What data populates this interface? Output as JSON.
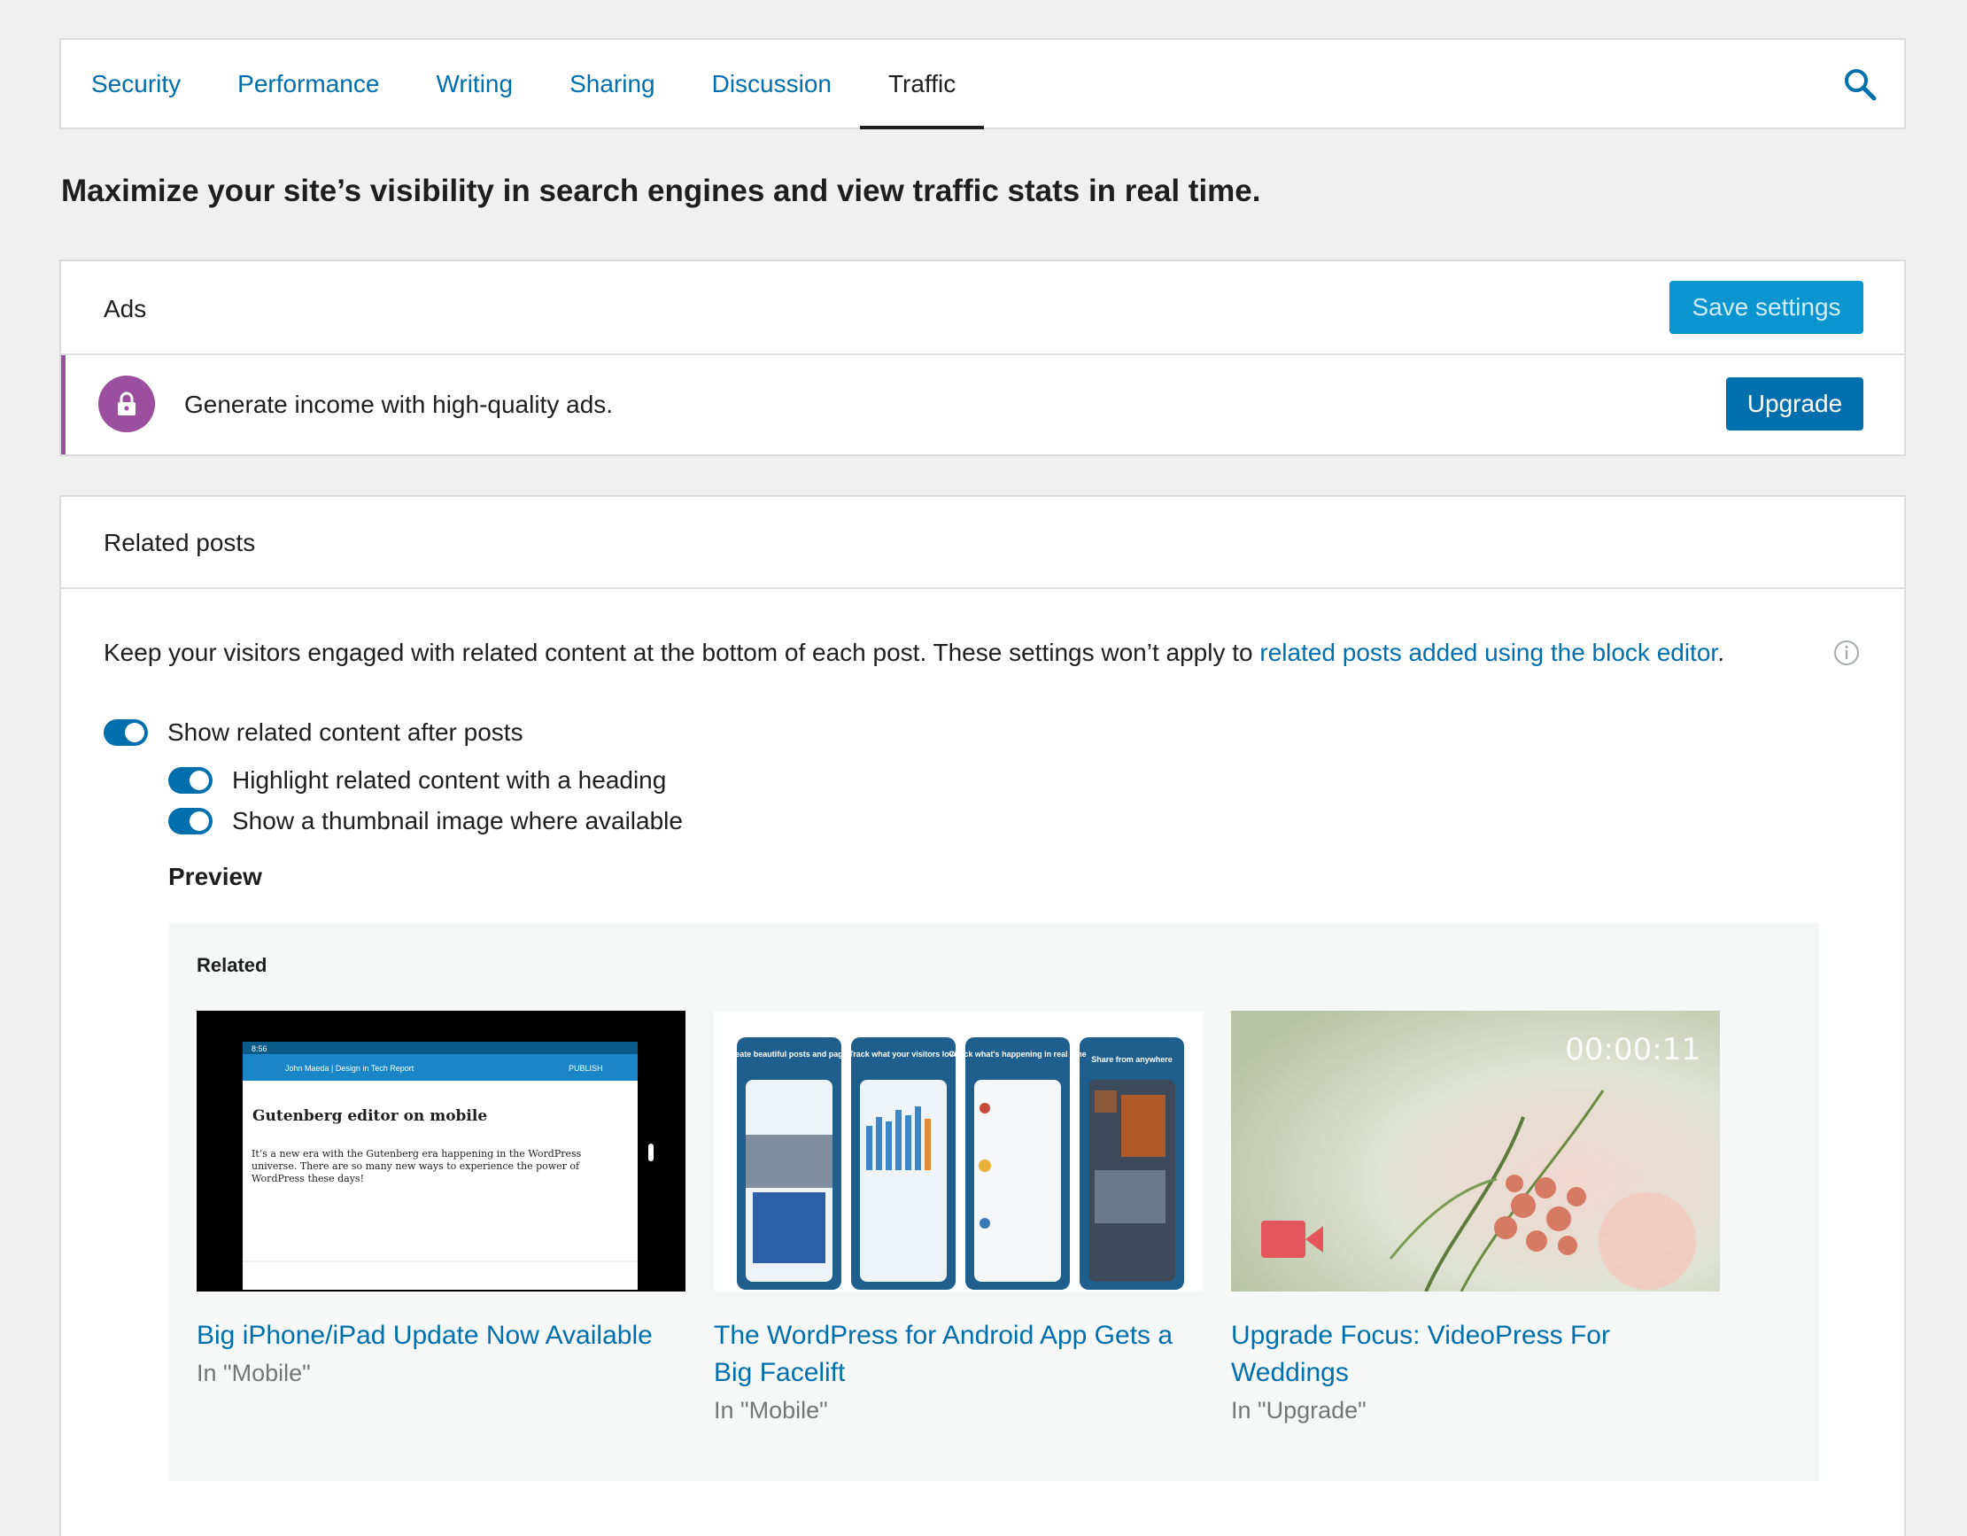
{
  "nav": {
    "tabs": [
      {
        "label": "Security"
      },
      {
        "label": "Performance"
      },
      {
        "label": "Writing"
      },
      {
        "label": "Sharing"
      },
      {
        "label": "Discussion"
      },
      {
        "label": "Traffic",
        "active": true
      }
    ],
    "search_icon": "search-icon"
  },
  "intro": "Maximize your site’s visibility in search engines and view traffic stats in real time.",
  "ads": {
    "title": "Ads",
    "save_label": "Save settings",
    "upsell_text": "Generate income with high-quality ads.",
    "upgrade_label": "Upgrade",
    "lock_icon": "lock-icon"
  },
  "related_posts": {
    "title": "Related posts",
    "description_prefix": "Keep your visitors engaged with related content at the bottom of each post. These settings won’t apply to ",
    "description_link": "related posts added using the block editor",
    "description_suffix": ".",
    "toggles": [
      {
        "label": "Show related content after posts",
        "on": true
      },
      {
        "label": "Highlight related content with a heading",
        "on": true
      },
      {
        "label": "Show a thumbnail image where available",
        "on": true
      }
    ],
    "preview_label": "Preview",
    "preview": {
      "heading": "Related",
      "posts": [
        {
          "title": "Big iPhone/iPad Update Now Available",
          "category": "In \"Mobile\"",
          "thumb": {
            "doc_title": "Gutenberg editor on mobile",
            "doc_text": "It’s a new era with the Gutenberg era happening in the WordPress universe. There are so many new ways to experience the power of WordPress these days!",
            "bar_label": "John Maeda | Design in Tech Report",
            "publish": "PUBLISH",
            "time": "8:56"
          }
        },
        {
          "title": "The WordPress for Android App Gets a Big Facelift",
          "category": "In \"Mobile\"",
          "thumb": {
            "captions": [
              "Create beautiful posts and pages",
              "Track what your visitors love",
              "Check what's happening in real time",
              "Share from anywhere"
            ]
          }
        },
        {
          "title": "Upgrade Focus: VideoPress For Weddings",
          "category": "In \"Upgrade\"",
          "thumb": {
            "timecode": "00:00:11",
            "camera_icon": "video-camera-icon"
          }
        }
      ]
    }
  },
  "colors": {
    "accent": "#006fad",
    "accent_light": "#0b95d0",
    "upsell": "#9b4f9f"
  }
}
